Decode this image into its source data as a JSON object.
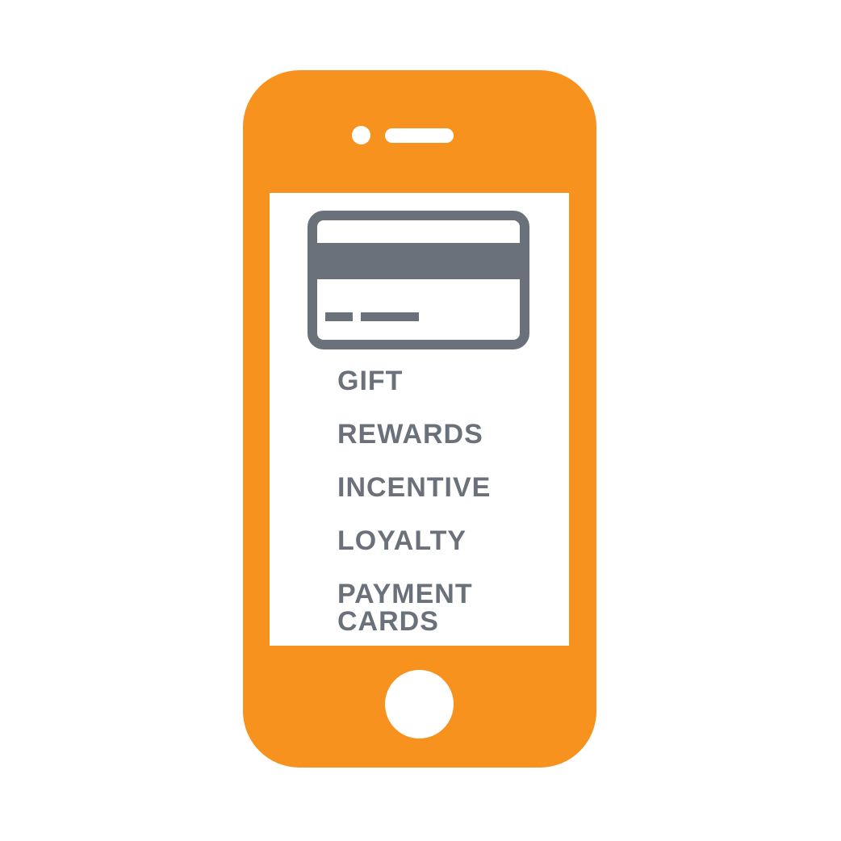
{
  "colors": {
    "phone": "#f7921e",
    "icon": "#6b717a",
    "text": "#6b717a",
    "screen": "#ffffff"
  },
  "icons": {
    "card": "credit-card-icon"
  },
  "menu": {
    "items": [
      "GIFT",
      "REWARDS",
      "INCENTIVE",
      "LOYALTY",
      "PAYMENT\nCARDS"
    ]
  }
}
